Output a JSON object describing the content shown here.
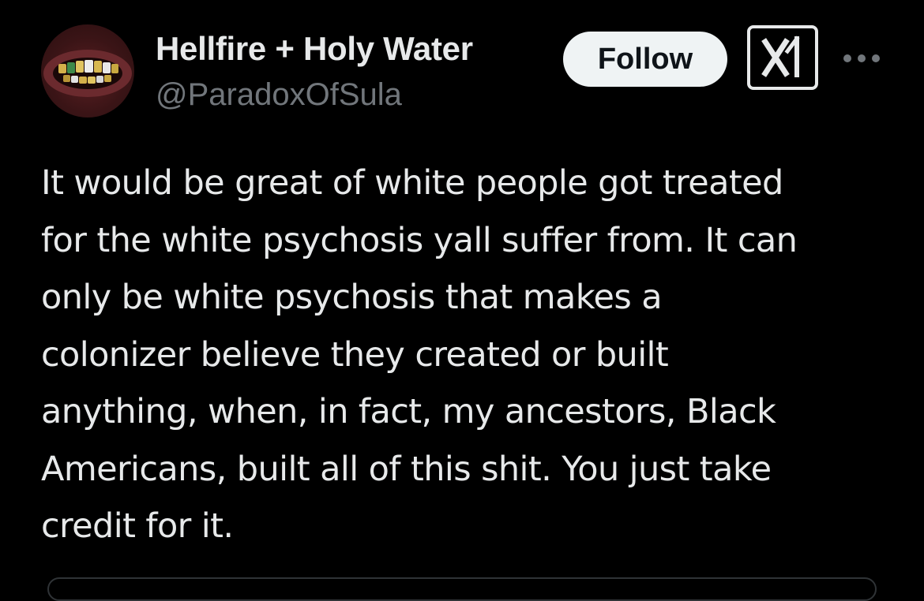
{
  "post": {
    "author": {
      "display_name": "Hellfire + Holy Water",
      "handle": "@ParadoxOfSula",
      "avatar_icon": "gold-grills-mouth-avatar"
    },
    "actions": {
      "follow_label": "Follow",
      "grok_icon": "grok-icon",
      "more_icon": "more-horizontal-icon"
    },
    "text_lines": [
      "It would be great of white people got treated",
      "for the white psychosis yall suffer from. It can",
      "only be white psychosis that makes a",
      "colonizer believe they created or built",
      "anything, when, in fact, my ancestors, Black",
      "Americans, built all of this shit. You just take",
      "credit for it."
    ]
  },
  "colors": {
    "background": "#000000",
    "primary_text": "#e7e9ea",
    "secondary_text": "#71767b",
    "follow_button_bg": "#eff3f4",
    "follow_button_text": "#0f1419",
    "border": "#2f3336"
  }
}
